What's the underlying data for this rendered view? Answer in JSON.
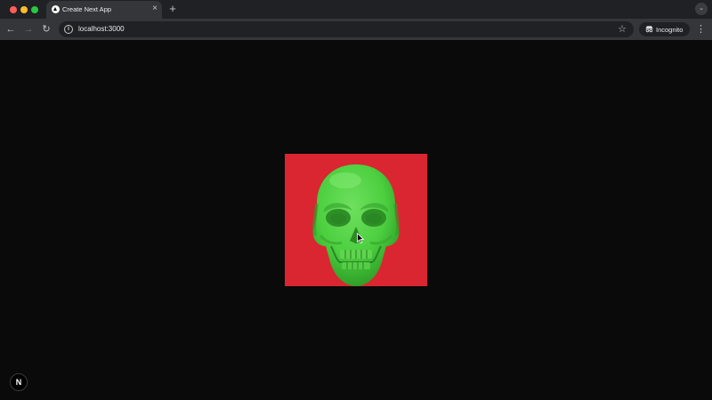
{
  "window": {
    "traffic_lights": [
      "close",
      "minimize",
      "zoom"
    ],
    "colors": {
      "close": "#ff5f57",
      "minimize": "#febc2e",
      "zoom": "#28c840"
    }
  },
  "tabs": [
    {
      "title": "Create Next App",
      "favicon": "nextjs-triangle-icon",
      "close_glyph": "×"
    }
  ],
  "tabstrip": {
    "new_tab_glyph": "+",
    "tab_search_glyph": "⌄"
  },
  "toolbar": {
    "back_glyph": "←",
    "forward_glyph": "→",
    "reload_glyph": "↻",
    "url": "localhost:3000",
    "site_info_glyph": "i",
    "bookmark_glyph": "☆",
    "incognito_label": "Incognito",
    "menu_glyph": "⋮"
  },
  "page": {
    "background": "#0a0a0a",
    "image": {
      "subject": "green skull",
      "background_color": "#d92630",
      "skull_color": "#4ccf3f"
    },
    "dev_badge_label": "N"
  }
}
